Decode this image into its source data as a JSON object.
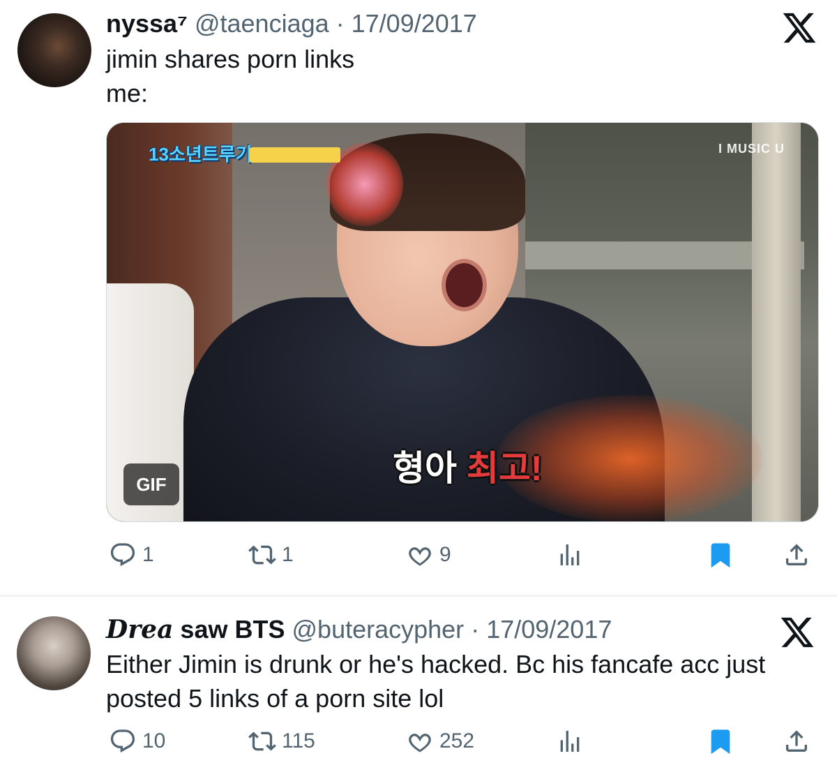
{
  "tweets": [
    {
      "display_name": "nyssa⁷",
      "handle": "@taenciaga",
      "separator": "·",
      "date": "17/09/2017",
      "text": "jimin shares porn links\nme:",
      "media": {
        "badge": "GIF",
        "show_logo": "13소년트루기",
        "channel_logo": "I MUSIC U",
        "subtitle_plain": "형아 ",
        "subtitle_highlight": "최고!"
      },
      "stats": {
        "replies": "1",
        "retweets": "1",
        "likes": "9"
      }
    },
    {
      "display_name_fancy": "Drea",
      "display_name_rest": " saw BTS",
      "handle": "@buteracypher",
      "separator": "·",
      "date": "17/09/2017",
      "text": "Either Jimin is drunk or he's hacked. Bc his fancafe acc just posted 5 links of a porn site lol",
      "stats": {
        "replies": "10",
        "retweets": "115",
        "likes": "252"
      }
    }
  ],
  "icons": {
    "platform": "x-logo-icon",
    "reply": "speech-bubble-icon",
    "retweet": "retweet-arrows-icon",
    "like": "heart-icon",
    "views": "bar-chart-icon",
    "bookmark": "bookmark-icon",
    "share": "share-upload-icon"
  },
  "colors": {
    "text": "#0f1419",
    "secondary": "#536471",
    "bookmark": "#1d9bf0"
  }
}
